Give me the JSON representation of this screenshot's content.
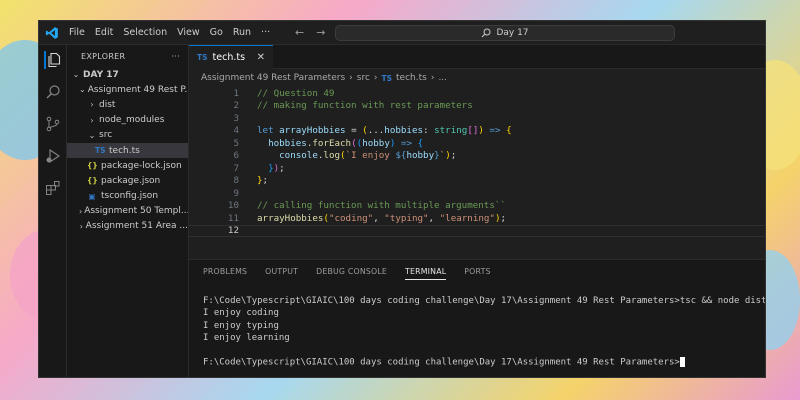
{
  "window": {
    "menu": [
      "File",
      "Edit",
      "Selection",
      "View",
      "Go",
      "Run",
      "···"
    ],
    "search_text": "Day 17"
  },
  "sidebar": {
    "header": "EXPLORER",
    "more": "···",
    "root": "DAY 17",
    "items": [
      {
        "label": "Assignment 49 Rest P...",
        "kind": "folder",
        "open": true,
        "depth": 1
      },
      {
        "label": "dist",
        "kind": "folder",
        "open": false,
        "depth": 2
      },
      {
        "label": "node_modules",
        "kind": "folder",
        "open": false,
        "depth": 2
      },
      {
        "label": "src",
        "kind": "folder",
        "open": true,
        "depth": 2
      },
      {
        "label": "tech.ts",
        "kind": "ts",
        "depth": 3,
        "selected": true
      },
      {
        "label": "package-lock.json",
        "kind": "json",
        "depth": 2
      },
      {
        "label": "package.json",
        "kind": "json",
        "depth": 2
      },
      {
        "label": "tsconfig.json",
        "kind": "tsconfig",
        "depth": 2
      },
      {
        "label": "Assignment 50 Templ...",
        "kind": "folder",
        "open": false,
        "depth": 1
      },
      {
        "label": "Assignment 51 Area ...",
        "kind": "folder",
        "open": false,
        "depth": 1
      }
    ]
  },
  "editor": {
    "tab_badge": "TS",
    "tab_label": "tech.ts",
    "tab_close": "✕",
    "breadcrumb": {
      "folder": "Assignment 49 Rest Parameters",
      "src": "src",
      "file": "tech.ts",
      "more": "..."
    },
    "current_line": 12,
    "lines": [
      [
        [
          "c-comment",
          "// Question 49"
        ]
      ],
      [
        [
          "c-comment",
          "// making function with rest parameters"
        ]
      ],
      [],
      [
        [
          "c-kw",
          "let "
        ],
        [
          "c-var",
          "arrayHobbies"
        ],
        [
          "c-punc",
          " = "
        ],
        [
          "c-brace1",
          "("
        ],
        [
          "c-punc",
          "..."
        ],
        [
          "c-var",
          "hobbies"
        ],
        [
          "c-punc",
          ": "
        ],
        [
          "c-type",
          "string"
        ],
        [
          "c-brace2",
          "[]"
        ],
        [
          "c-brace1",
          ")"
        ],
        [
          "c-kw",
          " => "
        ],
        [
          "c-brace1",
          "{"
        ]
      ],
      [
        [
          "c-punc",
          "  "
        ],
        [
          "c-var",
          "hobbies"
        ],
        [
          "c-punc",
          "."
        ],
        [
          "c-fn",
          "forEach"
        ],
        [
          "c-brace2",
          "("
        ],
        [
          "c-brace3",
          "("
        ],
        [
          "c-var",
          "hobby"
        ],
        [
          "c-brace3",
          ")"
        ],
        [
          "c-kw",
          " => "
        ],
        [
          "c-brace3",
          "{"
        ]
      ],
      [
        [
          "c-punc",
          "    "
        ],
        [
          "c-var",
          "console"
        ],
        [
          "c-punc",
          "."
        ],
        [
          "c-fn",
          "log"
        ],
        [
          "c-brace1",
          "("
        ],
        [
          "c-str",
          "`I enjoy "
        ],
        [
          "c-kw",
          "${"
        ],
        [
          "c-var",
          "hobby"
        ],
        [
          "c-kw",
          "}"
        ],
        [
          "c-str",
          "`"
        ],
        [
          "c-brace1",
          ")"
        ],
        [
          "c-punc",
          ";"
        ]
      ],
      [
        [
          "c-punc",
          "  "
        ],
        [
          "c-brace3",
          "}"
        ],
        [
          "c-brace2",
          ")"
        ],
        [
          "c-punc",
          ";"
        ]
      ],
      [
        [
          "c-brace1",
          "}"
        ],
        [
          "c-punc",
          ";"
        ]
      ],
      [],
      [
        [
          "c-comment",
          "// calling function with multiple arguments``"
        ]
      ],
      [
        [
          "c-fn",
          "arrayHobbies"
        ],
        [
          "c-brace1",
          "("
        ],
        [
          "c-str",
          "\"coding\""
        ],
        [
          "c-punc",
          ", "
        ],
        [
          "c-str",
          "\"typing\""
        ],
        [
          "c-punc",
          ", "
        ],
        [
          "c-str",
          "\"learning\""
        ],
        [
          "c-brace1",
          ")"
        ],
        [
          "c-punc",
          ";"
        ]
      ],
      []
    ]
  },
  "panel": {
    "tabs": [
      "PROBLEMS",
      "OUTPUT",
      "DEBUG CONSOLE",
      "TERMINAL",
      "PORTS"
    ],
    "active_tab": "TERMINAL",
    "terminal_lines": [
      "F:\\Code\\Typescript\\GIAIC\\100 days coding challenge\\Day 17\\Assignment 49 Rest Parameters>tsc && node dist/tech.js",
      "I enjoy coding",
      "I enjoy typing",
      "I enjoy learning",
      "",
      "F:\\Code\\Typescript\\GIAIC\\100 days coding challenge\\Day 17\\Assignment 49 Rest Parameters>"
    ]
  },
  "colors": {
    "accent": "#0078d4",
    "ts_blue": "#3178c6",
    "json_yellow": "#cbcb41"
  }
}
